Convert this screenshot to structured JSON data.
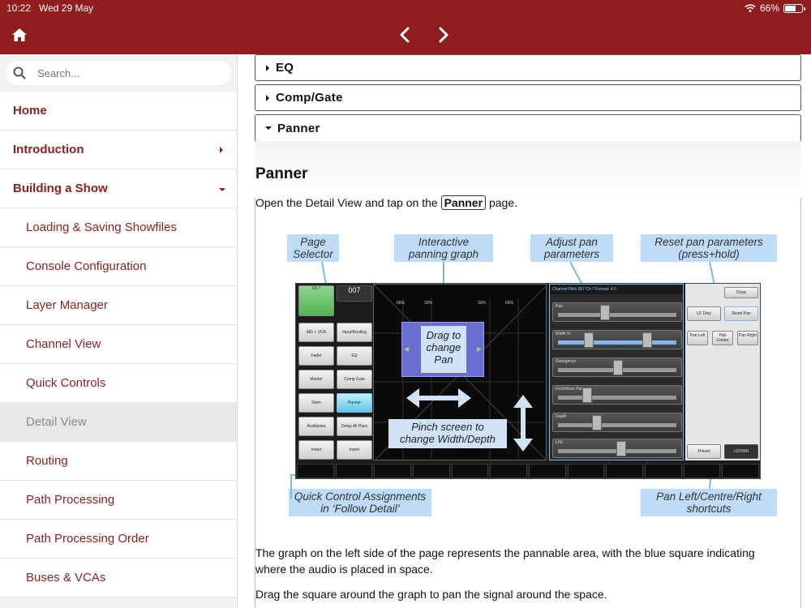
{
  "status": {
    "time": "10:22",
    "date": "Wed 29 May",
    "battery": "66%",
    "battery_level": 0.66
  },
  "topbar": {
    "home_icon": "home-icon",
    "back_icon": "chevron-left-icon",
    "forward_icon": "chevron-right-icon",
    "accent": "#8f1d1d"
  },
  "sidebar": {
    "search_placeholder": "Search...",
    "items": [
      {
        "label": "Home"
      },
      {
        "label": "Introduction"
      },
      {
        "label": "Building a Show"
      },
      {
        "label": "Loading & Saving Showfiles"
      },
      {
        "label": "Console Configuration"
      },
      {
        "label": "Layer Manager"
      },
      {
        "label": "Channel View"
      },
      {
        "label": "Quick Controls"
      },
      {
        "label": "Detail View"
      },
      {
        "label": "Routing"
      },
      {
        "label": "Path Processing"
      },
      {
        "label": "Path Processing Order"
      },
      {
        "label": "Buses & VCAs"
      }
    ]
  },
  "content": {
    "accordions": [
      {
        "label": "EQ"
      },
      {
        "label": "Comp/Gate"
      },
      {
        "label": "Panner"
      }
    ],
    "section_title": "Panner",
    "intro_before": "Open the Detail View and tap on the",
    "intro_key": "Panner",
    "intro_after": "page.",
    "para1": "The graph on the left side of the page represents the pannable area, with the blue square indicating where the audio is placed in space.",
    "para2": "Drag the square around the graph to pan the signal around the space."
  },
  "figure": {
    "callouts": {
      "page_selector": "Page\nSelector",
      "interactive_graph": "Interactive\npanning graph",
      "adjust_params": "Adjust pan\nparameters",
      "reset_params": "Reset pan parameters\n(press+hold)",
      "quick_control": "Quick Control Assignments\nin ‘Follow Detail’",
      "pan_shortcuts": "Pan Left/Centre/Right\nshortcuts"
    },
    "drag_box": "Drag to\nchange\nPan",
    "pinch_box": "Pinch screen to\nchange Width/Depth",
    "console": {
      "channel_label": "Ch 7",
      "channel_number": "007",
      "left_buttons": [
        "MG + VCA",
        "Fader",
        "Master",
        "Stem",
        "Auxiliaries",
        "Insert"
      ],
      "right_buttons": [
        "Input/Routing",
        "EQ",
        "Comp Gate",
        "Panner",
        "Delay All Pass",
        "Insert"
      ],
      "graph_ticks": [
        "66%",
        "33%",
        "33%",
        "66%"
      ],
      "params_header": "Channel PA/s  007      Ch 7      Format: 4.0",
      "param_rows": [
        "Pan",
        "Width  %",
        "Divergence",
        "Front/Rear Pan",
        "Depth",
        "LFE"
      ],
      "close_label": "Close",
      "lf_only": "LF Only",
      "reset_pan": "Reset Pan",
      "pan_left": "Pan Left",
      "pan_centre": "Pan Centre",
      "pan_right": "Pan Right",
      "preset": "Preset",
      "format": "L62/58R"
    }
  }
}
